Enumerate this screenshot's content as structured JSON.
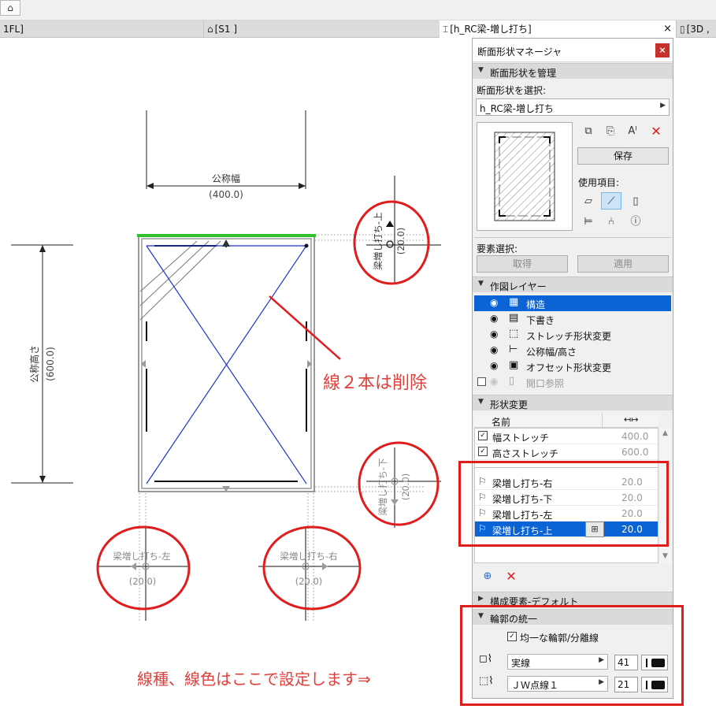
{
  "colors": {
    "annotation": "#e0403c",
    "highlight_box": "#e01d1d",
    "selection": "#0a64d6",
    "green_edge": "#2fbf2f",
    "blue_lines": "#2233c8"
  },
  "toolbar": {
    "home_icon": "house-icon"
  },
  "tabs": [
    {
      "label": "1FL]"
    },
    {
      "label": "[S1 ]",
      "icon": "house-icon"
    },
    {
      "label": "[h_RC梁-増し打ち]",
      "icon": "beam-icon",
      "close": "×"
    },
    {
      "label": "[3D ,",
      "icon": "cube-icon"
    }
  ],
  "drawing": {
    "width_label": "公称幅",
    "width_value": "(400.0)",
    "height_label": "公称高さ",
    "height_value": "(600.0)",
    "handles": [
      {
        "label": "梁増し打ち-上",
        "value": "(20.0)"
      },
      {
        "label": "梁増し打ち-下",
        "value": "(20.0)"
      },
      {
        "label": "梁増し打ち-左",
        "value": "(20.0)"
      },
      {
        "label": "梁増し打ち-右",
        "value": "(20.0)"
      }
    ]
  },
  "annotations": {
    "delete_lines": "線２本は削除",
    "set_linetype": "線種、線色はここで設定します⇒"
  },
  "panel": {
    "title": "断面形状マネージャ",
    "close": "×",
    "manage_section": "断面形状を管理",
    "select_label": "断面形状を選択:",
    "selected_profile": "h_RC梁-増し打ち",
    "save_button": "保存",
    "usage_label": "使用項目:",
    "element_select_label": "要素選択:",
    "get_button": "取得",
    "apply_button": "適用",
    "layers_section": "作図レイヤー",
    "layers": [
      {
        "name": "構造",
        "selected": true,
        "visible": true,
        "icon": "structure-icon"
      },
      {
        "name": "下書き",
        "selected": false,
        "visible": true,
        "icon": "draft-icon"
      },
      {
        "name": "ストレッチ形状変更",
        "selected": false,
        "visible": true,
        "icon": "stretch-icon"
      },
      {
        "name": "公称幅/高さ",
        "selected": false,
        "visible": true,
        "icon": "nominal-icon"
      },
      {
        "name": "オフセット形状変更",
        "selected": false,
        "visible": true,
        "icon": "offset-icon"
      },
      {
        "name": "開口参照",
        "selected": false,
        "visible": false,
        "icon": "opening-icon"
      }
    ],
    "modify_section": "形状変更",
    "name_header": "名前",
    "stretch_rows": [
      {
        "name": "幅ストレッチ",
        "value": "400.0",
        "checked": "☑"
      },
      {
        "name": "高さストレッチ",
        "value": "600.0",
        "checked": "☑"
      }
    ],
    "offset_rows": [
      {
        "name": "梁増し打ち-右",
        "value": "20.0"
      },
      {
        "name": "梁増し打ち-下",
        "value": "20.0"
      },
      {
        "name": "梁増し打ち-左",
        "value": "20.0"
      },
      {
        "name": "梁増し打ち-上",
        "value": "20.0",
        "selected": true
      }
    ],
    "component_section": "構成要素-デフォルト",
    "contour_section": "輪郭の統一",
    "uniform_checkbox": "均一な輪郭/分離線",
    "line_type_1": "実線",
    "pen_1": "41",
    "line_type_2": "ＪＷ点線１",
    "pen_2": "21"
  }
}
